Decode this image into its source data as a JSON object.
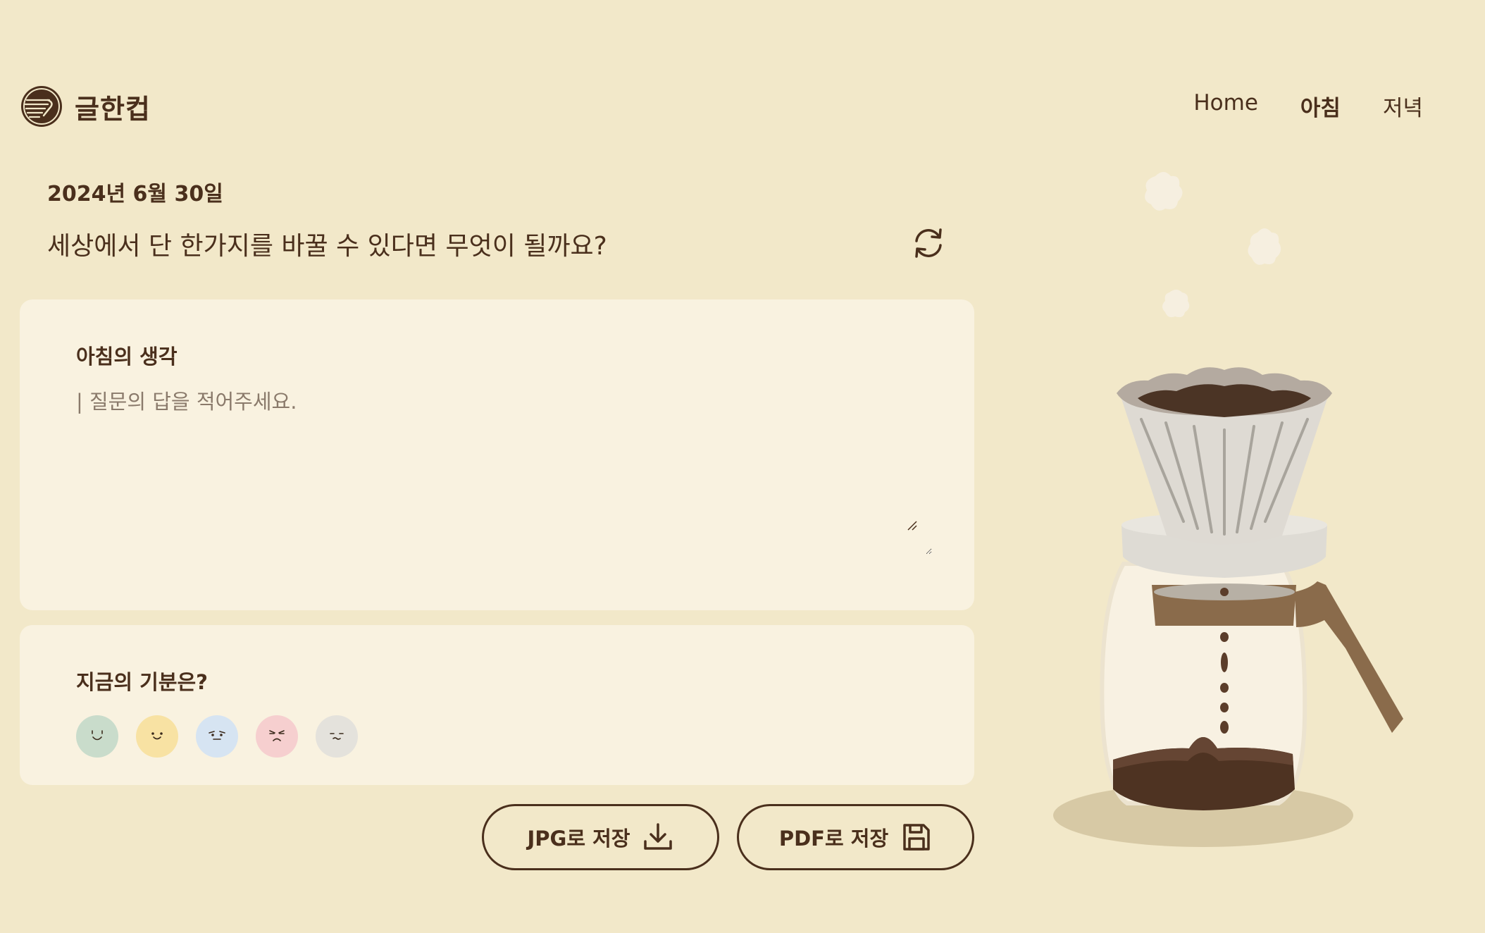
{
  "app": {
    "title": "글한컵"
  },
  "nav": {
    "items": [
      "Home",
      "아침",
      "저녁"
    ],
    "active": "아침"
  },
  "date": "2024년 6월 30일",
  "question": "세상에서 단 한가지를 바꿀 수 있다면 무엇이 될까요?",
  "answer_card": {
    "title": "아침의 생각",
    "placeholder": "| 질문의 답을 적어주세요.",
    "value": ""
  },
  "mood_card": {
    "title": "지금의 기분은?",
    "moods": [
      {
        "name": "happy",
        "color": "#c9dccb"
      },
      {
        "name": "content",
        "color": "#f8e2a3"
      },
      {
        "name": "worried",
        "color": "#d6e4f2"
      },
      {
        "name": "angry",
        "color": "#f6cfcf"
      },
      {
        "name": "neutral",
        "color": "#e4e2dc"
      }
    ]
  },
  "buttons": {
    "jpg": "JPG로 저장",
    "pdf": "PDF로 저장"
  },
  "colors": {
    "background": "#f2e8c9",
    "card": "#f9f2e0",
    "text": "#4a2f1c"
  }
}
